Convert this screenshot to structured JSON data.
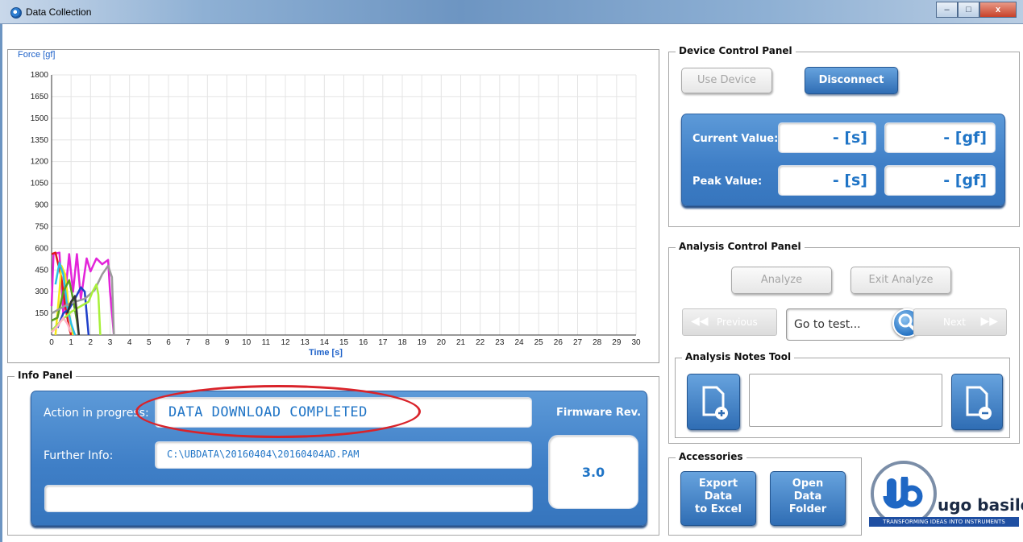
{
  "window": {
    "title": "Data Collection",
    "minimize_label": "–",
    "maximize_label": "□",
    "close_label": "x"
  },
  "chart_data": {
    "type": "line",
    "ylabel": "Force [gf]",
    "xlabel": "Time [s]",
    "xlim": [
      0,
      30
    ],
    "ylim": [
      0,
      1800
    ],
    "yticks": [
      150,
      300,
      450,
      600,
      750,
      900,
      1050,
      1200,
      1350,
      1500,
      1650,
      1800
    ],
    "xticks": [
      0,
      1,
      2,
      3,
      4,
      5,
      6,
      7,
      8,
      9,
      10,
      11,
      12,
      13,
      14,
      15,
      16,
      17,
      18,
      19,
      20,
      21,
      22,
      23,
      24,
      25,
      26,
      27,
      28,
      29,
      30
    ],
    "grid": true,
    "series": [
      {
        "color": "#e323d9",
        "points": [
          [
            0,
            200
          ],
          [
            0.1,
            560
          ],
          [
            0.4,
            570
          ],
          [
            0.6,
            150
          ],
          [
            0.9,
            560
          ],
          [
            1.1,
            300
          ],
          [
            1.3,
            560
          ],
          [
            1.5,
            250
          ],
          [
            1.8,
            530
          ],
          [
            2.0,
            440
          ],
          [
            2.3,
            530
          ],
          [
            2.6,
            490
          ],
          [
            2.9,
            520
          ],
          [
            3.0,
            300
          ],
          [
            3.2,
            0
          ]
        ]
      },
      {
        "color": "#e01a1a",
        "points": [
          [
            0,
            560
          ],
          [
            0.2,
            570
          ],
          [
            0.5,
            400
          ],
          [
            0.7,
            200
          ],
          [
            0.9,
            50
          ],
          [
            1.0,
            0
          ]
        ]
      },
      {
        "color": "#f5e81a",
        "points": [
          [
            0.2,
            0
          ],
          [
            0.4,
            300
          ],
          [
            0.5,
            480
          ],
          [
            0.7,
            420
          ],
          [
            0.9,
            150
          ],
          [
            1.1,
            0
          ]
        ]
      },
      {
        "color": "#1f3fc9",
        "points": [
          [
            0.3,
            50
          ],
          [
            0.6,
            150
          ],
          [
            0.9,
            180
          ],
          [
            1.2,
            250
          ],
          [
            1.5,
            330
          ],
          [
            1.7,
            300
          ],
          [
            1.8,
            150
          ],
          [
            1.9,
            0
          ]
        ]
      },
      {
        "color": "#28c0e8",
        "points": [
          [
            0.2,
            350
          ],
          [
            0.4,
            500
          ],
          [
            0.6,
            420
          ],
          [
            0.8,
            200
          ],
          [
            1.0,
            80
          ],
          [
            1.2,
            0
          ]
        ]
      },
      {
        "color": "#5a9e1f",
        "points": [
          [
            0,
            100
          ],
          [
            0.3,
            120
          ],
          [
            0.6,
            300
          ],
          [
            0.9,
            380
          ],
          [
            1.1,
            250
          ],
          [
            1.3,
            100
          ],
          [
            1.4,
            0
          ]
        ]
      },
      {
        "color": "#9b9b9b",
        "points": [
          [
            0,
            150
          ],
          [
            0.4,
            180
          ],
          [
            0.8,
            210
          ],
          [
            1.2,
            230
          ],
          [
            1.7,
            250
          ],
          [
            2.2,
            310
          ],
          [
            2.6,
            420
          ],
          [
            2.9,
            480
          ],
          [
            3.1,
            400
          ],
          [
            3.2,
            0
          ]
        ]
      },
      {
        "color": "#a8f03a",
        "points": [
          [
            0,
            30
          ],
          [
            0.5,
            100
          ],
          [
            1.0,
            160
          ],
          [
            1.5,
            200
          ],
          [
            1.9,
            230
          ],
          [
            2.1,
            300
          ],
          [
            2.3,
            350
          ],
          [
            2.4,
            280
          ],
          [
            2.5,
            0
          ]
        ]
      },
      {
        "color": "#ffb3c8",
        "points": [
          [
            0,
            20
          ],
          [
            0.3,
            60
          ],
          [
            0.6,
            120
          ],
          [
            0.8,
            80
          ],
          [
            1.0,
            20
          ]
        ]
      },
      {
        "color": "#333333",
        "points": [
          [
            0.8,
            150
          ],
          [
            1.0,
            230
          ],
          [
            1.2,
            270
          ],
          [
            1.3,
            150
          ],
          [
            1.4,
            0
          ]
        ]
      }
    ]
  },
  "device_panel": {
    "title": "Device Control Panel",
    "use_device_label": "Use Device",
    "disconnect_label": "Disconnect",
    "current_value_label": "Current Value:",
    "peak_value_label": "Peak Value:",
    "current_time": "- [s]",
    "current_force": "- [gf]",
    "peak_time": "- [s]",
    "peak_force": "- [gf]"
  },
  "analysis_panel": {
    "title": "Analysis Control Panel",
    "analyze_label": "Analyze",
    "exit_analyze_label": "Exit Analyze",
    "previous_label": "Previous",
    "goto_placeholder": "Go to test...",
    "next_label": "Next"
  },
  "notes_tool": {
    "title": "Analysis Notes Tool",
    "notes_value": ""
  },
  "info_panel": {
    "title": "Info Panel",
    "action_label": "Action in progress:",
    "action_value": "DATA DOWNLOAD COMPLETED",
    "further_label": "Further Info:",
    "further_value": "C:\\UBDATA\\20160404\\20160404AD.PAM",
    "extra_value": "",
    "firmware_label": "Firmware Rev.",
    "firmware_value": "3.0"
  },
  "accessories": {
    "title": "Accessories",
    "export_label": "Export\nData\nto Excel",
    "open_label": "Open\nData\nFolder"
  },
  "logo": {
    "name": "ugo basile",
    "tagline": "TRANSFORMING IDEAS INTO INSTRUMENTS"
  },
  "colors": {
    "panel_blue": "#3f7fc7",
    "accent_text": "#1f74c6",
    "highlight": "#d9232a"
  }
}
